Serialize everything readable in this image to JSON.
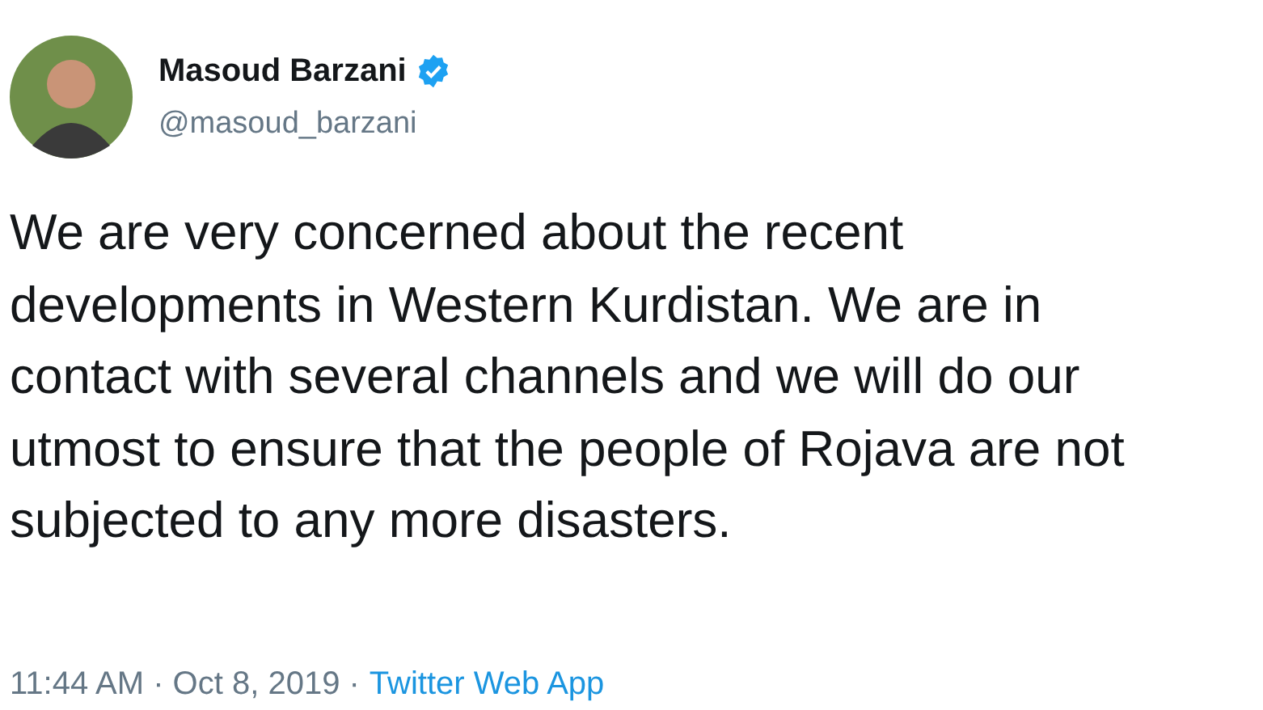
{
  "author": {
    "name": "Masoud Barzani",
    "verified": true,
    "handle": "@masoud_barzani"
  },
  "text": "We are very concerned about the recent developments in Western Kurdistan. We are in contact with several channels and we will do our utmost to ensure that the people of Rojava are not subjected to any more disasters.",
  "meta": {
    "timestamp": "11:44 AM · Oct 8, 2019 ·",
    "source": "Twitter Web App"
  }
}
